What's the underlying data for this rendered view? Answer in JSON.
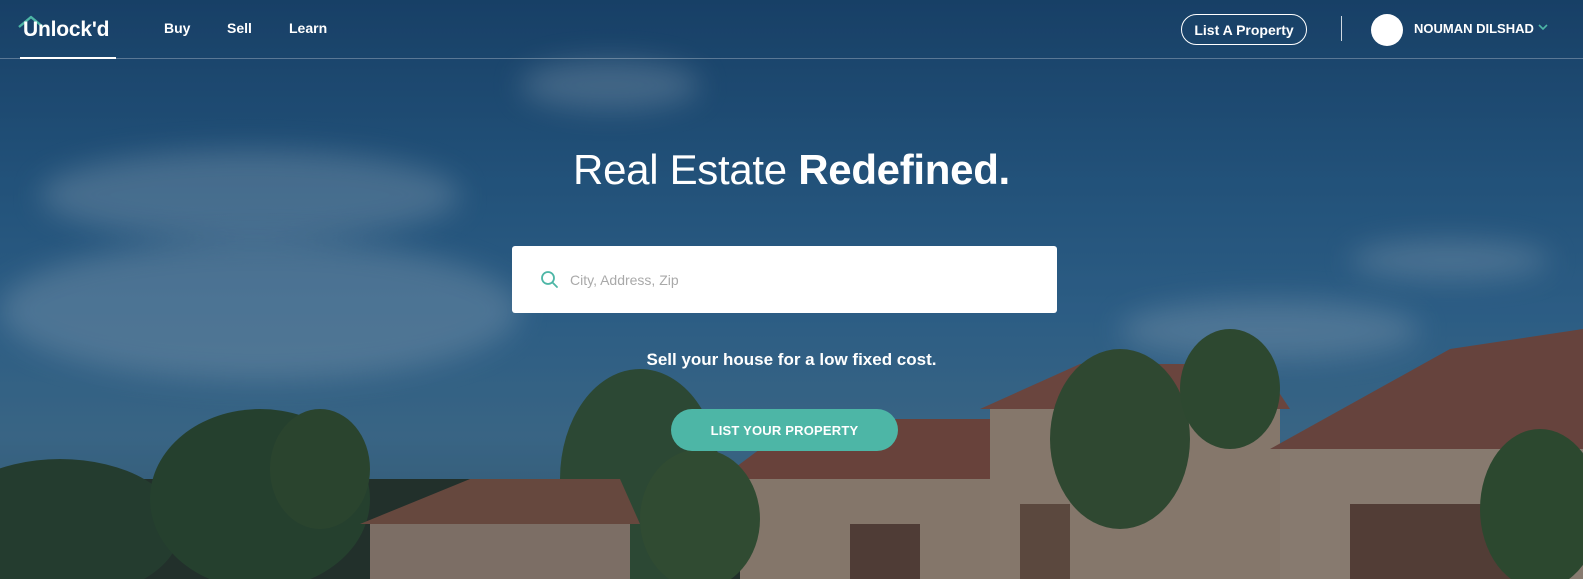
{
  "header": {
    "logo_text": "Unlock'd",
    "nav": [
      {
        "label": "Buy"
      },
      {
        "label": "Sell"
      },
      {
        "label": "Learn"
      }
    ],
    "list_property_label": "List A Property",
    "user_name": "NOUMAN DILSHAD"
  },
  "hero": {
    "headline_light": "Real Estate ",
    "headline_bold": "Redefined.",
    "search_placeholder": "City, Address, Zip",
    "tagline": "Sell your house for a low fixed cost.",
    "cta_label": "LIST YOUR PROPERTY"
  },
  "colors": {
    "accent": "#4db6a6",
    "sky": "#2b6796"
  },
  "icons": {
    "search": "search-icon",
    "logo_roof": "house-roof-icon",
    "user_menu": "chevron-down-icon"
  }
}
